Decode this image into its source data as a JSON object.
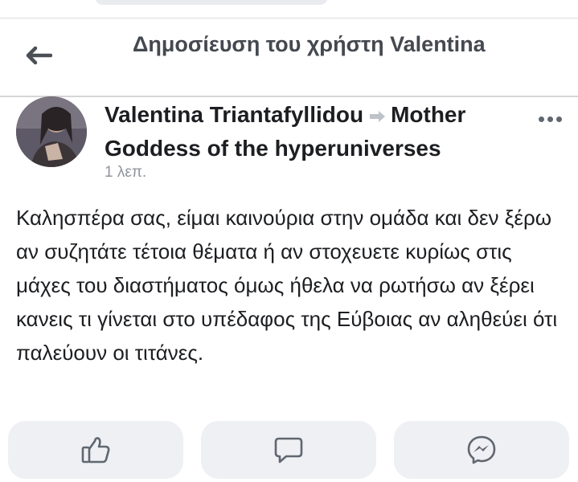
{
  "header": {
    "title": "Δημοσίευση του χρήστη Valentina"
  },
  "post": {
    "author": "Valentina Triantafyllidou",
    "group": "Mother Goddess of the hyperuniverses",
    "timestamp": "1 λεπ.",
    "text": "Καλησπέρα σας, είμαι καινούρια στην ομάδα και δεν ξέρω αν συζητάτε τέτοια θέματα ή αν στοχευετε κυρίως στις μάχες του διαστήματος όμως ήθελα να ρωτήσω αν ξέρει κανεις τι γίνεται στο υπέδαφος της Εύβοιας αν αληθεύει ότι παλεύουν οι τιτάνες."
  },
  "icons": {
    "back": "arrow-left-icon",
    "more": "more-options-icon",
    "like": "thumbs-up-icon",
    "comment": "comment-bubble-icon",
    "share": "messenger-icon"
  },
  "colors": {
    "text": "#1c1e21",
    "secondary_text": "#90949c",
    "header_text": "#444950",
    "icon": "#606770",
    "button_bg": "#eef0f3"
  }
}
